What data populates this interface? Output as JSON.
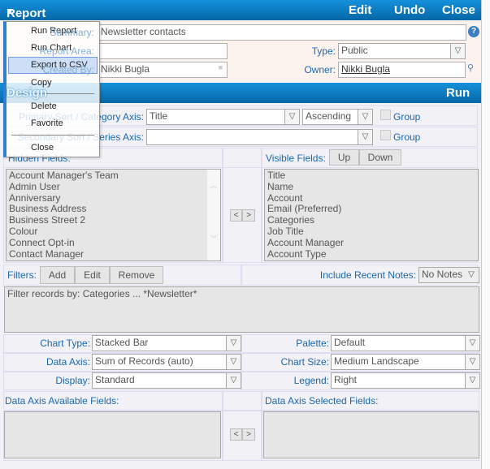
{
  "header": {
    "title": "Report",
    "edit": "Edit",
    "undo": "Undo",
    "close": "Close"
  },
  "details": {
    "summary_label": "Summary:",
    "summary": "Newsletter contacts",
    "report_area_label": "Report Area:",
    "report_area": "",
    "created_by_label": "Created By:",
    "created_by": "Nikki Bugla",
    "type_label": "Type:",
    "type": "Public",
    "owner_label": "Owner:",
    "owner": "Nikki Bugla"
  },
  "design": {
    "title": "Design",
    "run": "Run",
    "primary_label": "Primary Sort / Category Axis:",
    "primary": "Title",
    "order": "Ascending",
    "group": "Group",
    "secondary_label": "Secondary Sort / Series Axis:",
    "secondary": "",
    "hidden_label": "Hidden Fields:",
    "visible_label": "Visible Fields:",
    "up": "Up",
    "down": "Down",
    "hidden_fields": [
      "Account Manager's Team",
      "Admin User",
      "Anniversary",
      "Business Address",
      "Business Street 2",
      "Colour",
      "Connect Opt-in",
      "Contact Manager"
    ],
    "visible_fields": [
      "Title",
      "Name",
      "Account",
      "Email (Preferred)",
      "Categories",
      "Job Title",
      "Account Manager",
      "Account Type"
    ],
    "move_left": "<",
    "move_right": ">",
    "filters_label": "Filters:",
    "add": "Add",
    "edit": "Edit",
    "remove": "Remove",
    "notes_label": "Include Recent Notes:",
    "notes": "No Notes",
    "filter_text": "Filter records by: Categories ... *Newsletter*",
    "chart_type_label": "Chart Type:",
    "chart_type": "Stacked Bar",
    "palette_label": "Palette:",
    "palette": "Default",
    "data_axis_label": "Data Axis:",
    "data_axis": "Sum of Records (auto)",
    "chart_size_label": "Chart Size:",
    "chart_size": "Medium Landscape",
    "display_label": "Display:",
    "display": "Standard",
    "legend_label": "Legend:",
    "legend": "Right",
    "available_label": "Data Axis Available Fields:",
    "selected_label": "Data Axis Selected Fields:"
  },
  "menu": {
    "items": [
      "Run Report",
      "Run Chart",
      "Export to CSV",
      "Copy",
      "Delete",
      "Favorite",
      "Close"
    ],
    "highlighted": "Export to CSV"
  }
}
